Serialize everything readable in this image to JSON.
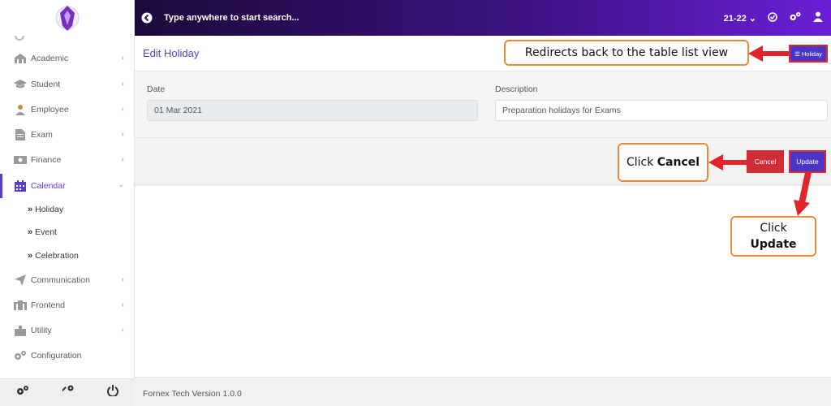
{
  "topbar": {
    "search_text": "Type anywhere to start search...",
    "session": "21-22"
  },
  "sidebar": {
    "items": [
      {
        "label": "Academic",
        "icon": "academic-icon"
      },
      {
        "label": "Student",
        "icon": "graduation-cap-icon"
      },
      {
        "label": "Employee",
        "icon": "employee-icon"
      },
      {
        "label": "Exam",
        "icon": "document-icon"
      },
      {
        "label": "Finance",
        "icon": "money-icon"
      },
      {
        "label": "Calendar",
        "icon": "calendar-icon"
      },
      {
        "label": "Communication",
        "icon": "paper-plane-icon"
      },
      {
        "label": "Frontend",
        "icon": "frontend-icon"
      },
      {
        "label": "Utility",
        "icon": "puzzle-icon"
      },
      {
        "label": "Configuration",
        "icon": "gears-icon"
      }
    ],
    "calendar_sub": [
      "Holiday",
      "Event",
      "Celebration"
    ]
  },
  "header": {
    "title": "Edit Holiday",
    "holiday_btn": "Holiday"
  },
  "form": {
    "date_label": "Date",
    "date_value": "01 Mar 2021",
    "description_label": "Description",
    "description_value": "Preparation holidays for Exams"
  },
  "actions": {
    "cancel": "Cancel",
    "update": "Update"
  },
  "footer": {
    "text": "Fornex Tech Version 1.0.0"
  },
  "annotations": {
    "redirect": "Redirects back to the table list view",
    "cancel_prefix": "Click ",
    "cancel_bold": "Cancel",
    "update_prefix": "Click",
    "update_bold": "Update"
  },
  "colors": {
    "accent": "#5b3cc4",
    "button_primary": "#4a35c7",
    "button_danger": "#d12d37",
    "annotation_arrow": "#e2252b",
    "callout_border": "#ea8a3a"
  }
}
